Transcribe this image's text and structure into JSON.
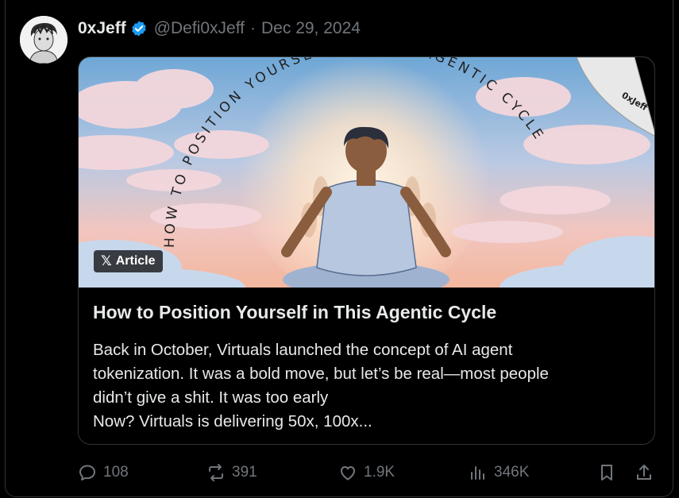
{
  "tweet": {
    "display_name": "0xJeff",
    "handle": "@Defi0xJeff",
    "separator": "·",
    "date": "Dec 29, 2024"
  },
  "card": {
    "image_badge": "Article",
    "image_caption_arc": "HOW TO POSITION YOURSELF IN THIS AGENTIC CYCLE",
    "corner_watermark": "0xJeff",
    "title": "How to Position Yourself in This Agentic Cycle",
    "description_lines": [
      "Back in October, Virtuals launched the concept of AI agent",
      "tokenization. It was a bold move, but let’s be real—most people",
      "didn’t give a shit. It was too early",
      "Now? Virtuals is delivering 50x, 100x..."
    ]
  },
  "actions": {
    "replies": "108",
    "reposts": "391",
    "likes": "1.9K",
    "views": "346K"
  },
  "colors": {
    "background": "#000000",
    "text_primary": "#e7e9ea",
    "text_secondary": "#71767b",
    "border": "#2f3336",
    "verified_blue": "#1d9bf0"
  },
  "icons": [
    "reply-icon",
    "repost-icon",
    "like-icon",
    "views-icon",
    "bookmark-icon",
    "share-icon",
    "verified-badge-icon",
    "x-logo-icon"
  ]
}
